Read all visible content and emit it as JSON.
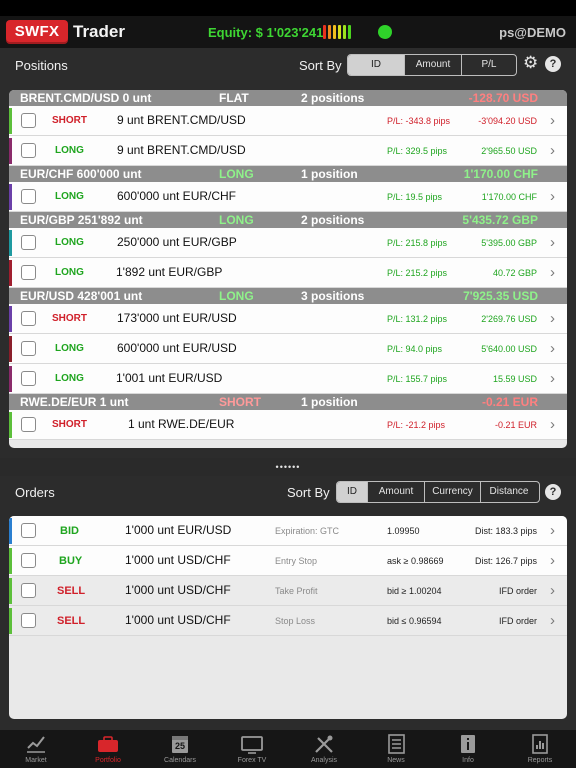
{
  "header": {
    "logo": "SWFX",
    "brand": "Trader",
    "equity": "Equity: $ 1'023'241",
    "user": "ps@DEMO",
    "strength_colors": [
      "#e8321e",
      "#f08a1e",
      "#f0c01e",
      "#d6e21e",
      "#9de21e",
      "#4bd41e"
    ],
    "status_color": "#2fd32a"
  },
  "positions": {
    "title": "Positions",
    "sort_label": "Sort By",
    "sort_options": [
      "ID",
      "Amount",
      "P/L"
    ],
    "selected": "ID",
    "groups": [
      {
        "name": "BRENT.CMD/USD 0 unt",
        "side": "FLAT",
        "count": "2 positions",
        "pl": "-128.70 USD",
        "pl_color": "#ff8080",
        "rows": [
          {
            "side": "SHORT",
            "desc": "9 unt BRENT.CMD/USD",
            "pips": "P/L: -343.8 pips",
            "value": "-3'094.20 USD",
            "neg": true,
            "accent": "#5cbf3a"
          },
          {
            "side": "LONG",
            "desc": "9 unt BRENT.CMD/USD",
            "pips": "P/L: 329.5 pips",
            "value": "2'965.50 USD",
            "neg": false,
            "accent": "#8a2a6a"
          }
        ]
      },
      {
        "name": "EUR/CHF 600'000 unt",
        "side": "LONG",
        "count": "1 position",
        "pl": "1'170.00 CHF",
        "pl_color": "#8ff28a",
        "rows": [
          {
            "side": "LONG",
            "desc": "600'000 unt EUR/CHF",
            "pips": "P/L: 19.5 pips",
            "value": "1'170.00 CHF",
            "neg": false,
            "accent": "#6a3fa8"
          }
        ]
      },
      {
        "name": "EUR/GBP 251'892 unt",
        "side": "LONG",
        "count": "2 positions",
        "pl": "5'435.72 GBP",
        "pl_color": "#8ff28a",
        "rows": [
          {
            "side": "LONG",
            "desc": "250'000 unt EUR/GBP",
            "pips": "P/L: 215.8 pips",
            "value": "5'395.00 GBP",
            "neg": false,
            "accent": "#1e9aa0"
          },
          {
            "side": "LONG",
            "desc": "1'892 unt EUR/GBP",
            "pips": "P/L: 215.2 pips",
            "value": "40.72 GBP",
            "neg": false,
            "accent": "#a01e2e"
          }
        ]
      },
      {
        "name": "EUR/USD 428'001 unt",
        "side": "LONG",
        "count": "3 positions",
        "pl": "7'925.35 USD",
        "pl_color": "#8ff28a",
        "rows": [
          {
            "side": "SHORT",
            "desc": "173'000 unt EUR/USD",
            "pips": "P/L: 131.2 pips",
            "value": "2'269.76 USD",
            "neg": false,
            "accent": "#6a3fa8"
          },
          {
            "side": "LONG",
            "desc": "600'000 unt EUR/USD",
            "pips": "P/L: 94.0 pips",
            "value": "5'640.00 USD",
            "neg": false,
            "accent": "#8a1e2a"
          },
          {
            "side": "LONG",
            "desc": "1'001 unt EUR/USD",
            "pips": "P/L: 155.7 pips",
            "value": "15.59 USD",
            "neg": false,
            "accent": "#8a2a6a"
          }
        ]
      },
      {
        "name": "RWE.DE/EUR 1 unt",
        "side": "SHORT",
        "count": "1 position",
        "pl": "-0.21 EUR",
        "pl_color": "#ff8080",
        "rows": [
          {
            "side": "SHORT",
            "desc": "1 unt RWE.DE/EUR",
            "pips": "P/L: -21.2 pips",
            "value": "-0.21 EUR",
            "neg": true,
            "accent": "#5cbf3a"
          }
        ]
      }
    ]
  },
  "divider": "••••••",
  "orders": {
    "title": "Orders",
    "sort_label": "Sort By",
    "sort_options": [
      "ID",
      "Amount",
      "Currency",
      "Distance"
    ],
    "selected": "ID",
    "rows": [
      {
        "side": "BID",
        "desc": "1'000 unt EUR/USD",
        "type": "Expiration: GTC",
        "price": "1.09950",
        "info": "Dist: 183.3 pips",
        "accent": "#2a7fd0",
        "shade": false
      },
      {
        "side": "BUY",
        "desc": "1'000 unt USD/CHF",
        "type": "Entry Stop",
        "price": "ask ≥ 0.98669",
        "info": "Dist: 126.7 pips",
        "accent": "#5cbf3a",
        "shade": false
      },
      {
        "side": "SELL",
        "desc": "1'000 unt USD/CHF",
        "type": "Take Profit",
        "price": "bid ≥ 1.00204",
        "info": "IFD order",
        "accent": "#5cbf3a",
        "shade": true
      },
      {
        "side": "SELL",
        "desc": "1'000 unt USD/CHF",
        "type": "Stop Loss",
        "price": "bid ≤ 0.96594",
        "info": "IFD order",
        "accent": "#5cbf3a",
        "shade": true
      }
    ]
  },
  "tabs": [
    {
      "label": "Market",
      "icon": "chart-icon",
      "active": false
    },
    {
      "label": "Portfolio",
      "icon": "briefcase-icon",
      "active": true
    },
    {
      "label": "Calendars",
      "icon": "calendar-icon",
      "active": false,
      "icon_text": "25"
    },
    {
      "label": "Forex TV",
      "icon": "tv-icon",
      "active": false
    },
    {
      "label": "Analysis",
      "icon": "tools-icon",
      "active": false
    },
    {
      "label": "News",
      "icon": "newspaper-icon",
      "active": false
    },
    {
      "label": "Info",
      "icon": "info-icon",
      "active": false
    },
    {
      "label": "Reports",
      "icon": "report-icon",
      "active": false
    }
  ],
  "colors": {
    "long": "#1fa51f",
    "short": "#d0202a",
    "pl_pos": "#1fa51f",
    "pl_neg": "#d0202a",
    "short_header": "#ff9a9a",
    "long_header": "#8ff28a",
    "flat_header": "#ffffff",
    "active_tab": "#d8262b"
  }
}
